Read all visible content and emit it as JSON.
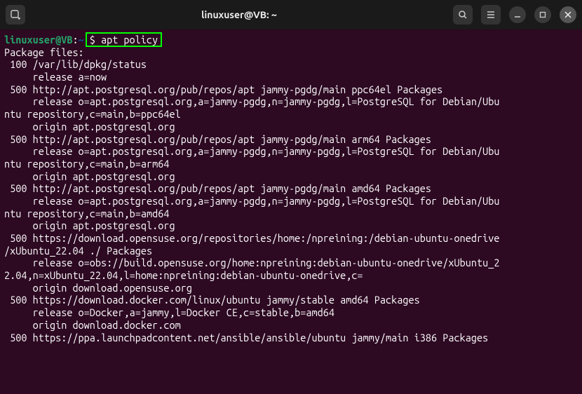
{
  "titlebar": {
    "title": "linuxuser@VB: ~"
  },
  "prompt": {
    "user_host": "linuxuser@VB",
    "colon": ":",
    "path": "~",
    "symbol": "$ ",
    "command": "apt policy"
  },
  "output": {
    "lines": [
      "Package files:",
      " 100 /var/lib/dpkg/status",
      "     release a=now",
      " 500 http://apt.postgresql.org/pub/repos/apt jammy-pgdg/main ppc64el Packages",
      "     release o=apt.postgresql.org,a=jammy-pgdg,n=jammy-pgdg,l=PostgreSQL for Debian/Ubu",
      "ntu repository,c=main,b=ppc64el",
      "     origin apt.postgresql.org",
      " 500 http://apt.postgresql.org/pub/repos/apt jammy-pgdg/main arm64 Packages",
      "     release o=apt.postgresql.org,a=jammy-pgdg,n=jammy-pgdg,l=PostgreSQL for Debian/Ubu",
      "ntu repository,c=main,b=arm64",
      "     origin apt.postgresql.org",
      " 500 http://apt.postgresql.org/pub/repos/apt jammy-pgdg/main amd64 Packages",
      "     release o=apt.postgresql.org,a=jammy-pgdg,n=jammy-pgdg,l=PostgreSQL for Debian/Ubu",
      "ntu repository,c=main,b=amd64",
      "     origin apt.postgresql.org",
      " 500 https://download.opensuse.org/repositories/home:/npreining:/debian-ubuntu-onedrive",
      "/xUbuntu_22.04 ./ Packages",
      "     release o=obs://build.opensuse.org/home:npreining:debian-ubuntu-onedrive/xUbuntu_2",
      "2.04,n=xUbuntu_22.04,l=home:npreining:debian-ubuntu-onedrive,c=",
      "     origin download.opensuse.org",
      " 500 https://download.docker.com/linux/ubuntu jammy/stable amd64 Packages",
      "     release o=Docker,a=jammy,l=Docker CE,c=stable,b=amd64",
      "     origin download.docker.com",
      " 500 https://ppa.launchpadcontent.net/ansible/ansible/ubuntu jammy/main i386 Packages"
    ]
  }
}
